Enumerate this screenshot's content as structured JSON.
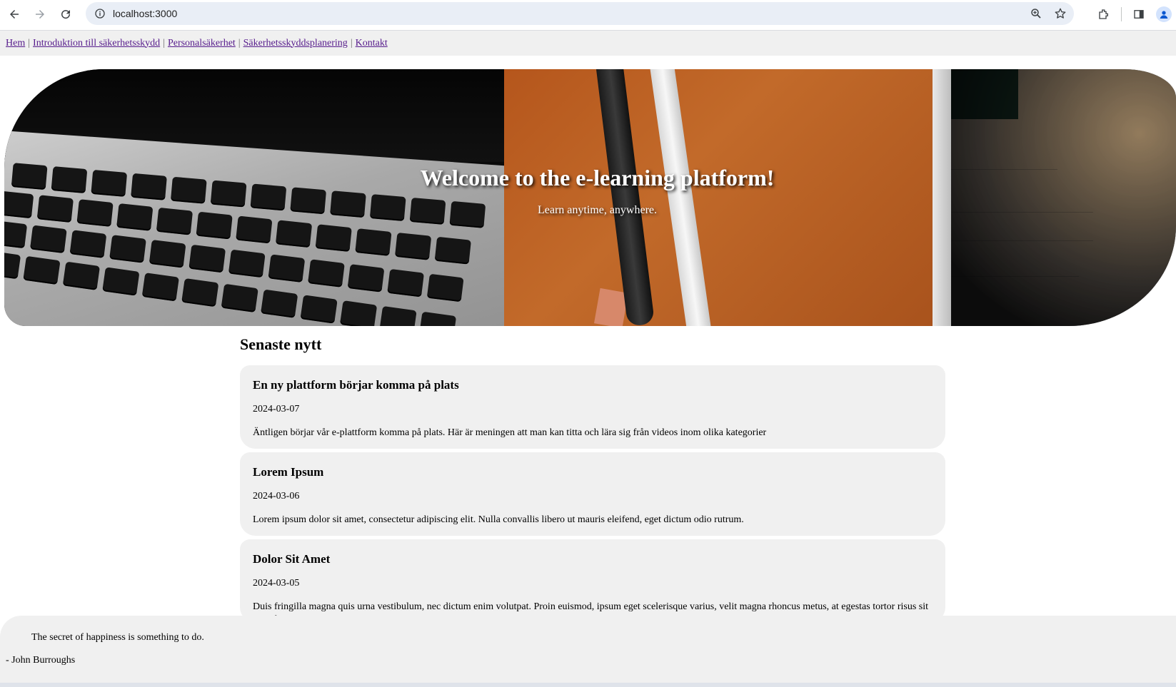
{
  "browser": {
    "url": "localhost:3000",
    "icons": [
      "back-icon",
      "forward-icon",
      "reload-icon",
      "site-info-icon",
      "zoom-icon",
      "bookmark-star-icon",
      "extensions-icon",
      "side-panel-icon",
      "profile-icon"
    ]
  },
  "nav": {
    "links": [
      "Hem",
      "Introduktion till säkerhetsskydd",
      "Personalsäkerhet",
      "Säkerhetsskyddsplanering",
      "Kontakt"
    ],
    "separator": "|",
    "link_color": "#551a8b"
  },
  "hero": {
    "title": "Welcome to the e-learning platform!",
    "subtitle": "Learn anytime, anywhere."
  },
  "news": {
    "heading": "Senaste nytt",
    "items": [
      {
        "title": "En ny plattform börjar komma på plats",
        "date": "2024-03-07",
        "body": "Äntligen börjar vår e-plattform komma på plats. Här är meningen att man kan titta och lära sig från videos inom olika kategorier"
      },
      {
        "title": "Lorem Ipsum",
        "date": "2024-03-06",
        "body": "Lorem ipsum dolor sit amet, consectetur adipiscing elit. Nulla convallis libero ut mauris eleifend, eget dictum odio rutrum."
      },
      {
        "title": "Dolor Sit Amet",
        "date": "2024-03-05",
        "body": "Duis fringilla magna quis urna vestibulum, nec dictum enim volutpat. Proin euismod, ipsum eget scelerisque varius, velit magna rhoncus metus, at egestas tortor risus sit amet lorem."
      }
    ]
  },
  "quote": {
    "text": "The secret of happiness is something to do.",
    "author": "- John Burroughs"
  },
  "colors": {
    "card_background": "#f0f0f0",
    "omnibox_background": "#e9eef6"
  }
}
